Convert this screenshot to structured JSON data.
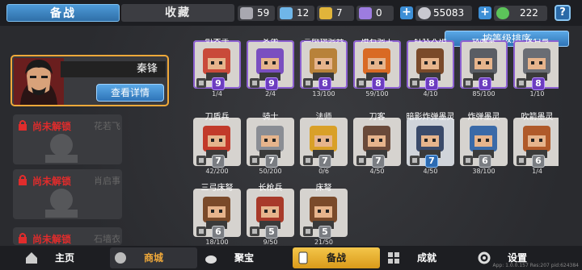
{
  "tabs": {
    "prep": "备战",
    "collect": "收藏"
  },
  "resources": [
    {
      "value": "59",
      "icon": "silver-token-icon",
      "color": "#a8a8b0"
    },
    {
      "value": "12",
      "icon": "blue-crystal-icon",
      "color": "#6fb6e8"
    },
    {
      "value": "7",
      "icon": "gold-badge-icon",
      "color": "#e0b43a"
    },
    {
      "value": "0",
      "icon": "purple-scroll-icon",
      "color": "#9d7ce0"
    }
  ],
  "coins": "55083",
  "gems": "222",
  "help": "?",
  "hero": {
    "name": "秦锋",
    "detail_button": "查看详情"
  },
  "locked": [
    {
      "status": "尚未解锁",
      "name": "花若飞"
    },
    {
      "status": "尚未解锁",
      "name": "肖启事"
    },
    {
      "status": "尚未解锁",
      "name": "石墙衣"
    }
  ],
  "sort_label": "按等级排序",
  "units": [
    {
      "name": "机关车",
      "cost": "9",
      "progress": "1/4",
      "tier": "p",
      "color": "#c94a3a"
    },
    {
      "name": "女巫",
      "cost": "9",
      "progress": "2/4",
      "tier": "p",
      "color": "#7a4fc0"
    },
    {
      "name": "三眼镜骑兵",
      "cost": "8",
      "progress": "13/100",
      "tier": "p",
      "color": "#b8823a"
    },
    {
      "name": "熔岩骑士",
      "cost": "8",
      "progress": "59/100",
      "tier": "p",
      "color": "#d96a24"
    },
    {
      "name": "红衣大炮",
      "cost": "8",
      "progress": "4/10",
      "tier": "p",
      "color": "#7a4a2a"
    },
    {
      "name": "铁魔黎",
      "cost": "8",
      "progress": "85/100",
      "tier": "p",
      "color": "#5a5d64"
    },
    {
      "name": "投石弩",
      "cost": "8",
      "progress": "1/10",
      "tier": "p",
      "color": "#6a6d74"
    },
    {
      "name": "刀盾兵",
      "cost": "7",
      "progress": "42/200",
      "tier": "g",
      "color": "#c23a2a"
    },
    {
      "name": "骑士",
      "cost": "7",
      "progress": "50/200",
      "tier": "g",
      "color": "#8a8d94"
    },
    {
      "name": "法师",
      "cost": "7",
      "progress": "0/6",
      "tier": "g",
      "color": "#d9a028"
    },
    {
      "name": "刀客",
      "cost": "7",
      "progress": "4/50",
      "tier": "g",
      "color": "#6a4a3a"
    },
    {
      "name": "暗影炸弹墨灵",
      "cost": "7",
      "progress": "4/50",
      "tier": "b",
      "color": "#3a4a6a"
    },
    {
      "name": "炸弹墨灵",
      "cost": "6",
      "progress": "38/100",
      "tier": "g",
      "color": "#3a6aa8"
    },
    {
      "name": "吹箭墨灵",
      "cost": "6",
      "progress": "1/4",
      "tier": "g",
      "color": "#b05a2a"
    },
    {
      "name": "三弓床弩",
      "cost": "6",
      "progress": "18/100",
      "tier": "g",
      "color": "#7a4a2a"
    },
    {
      "name": "长枪兵",
      "cost": "5",
      "progress": "9/50",
      "tier": "g",
      "color": "#a83a2a"
    },
    {
      "name": "床弩",
      "cost": "5",
      "progress": "21/50",
      "tier": "g",
      "color": "#7a4a2a"
    }
  ],
  "nav": [
    {
      "label": "主页",
      "icon": "home-icon"
    },
    {
      "label": "商城",
      "icon": "shop-icon"
    },
    {
      "label": "聚宝",
      "icon": "treasure-icon"
    },
    {
      "label": "备战",
      "icon": "card-icon"
    },
    {
      "label": "成就",
      "icon": "achievement-icon"
    },
    {
      "label": "设置",
      "icon": "gear-icon"
    }
  ],
  "version": "App: 1.0.0.157 Res:207 pid:624384"
}
